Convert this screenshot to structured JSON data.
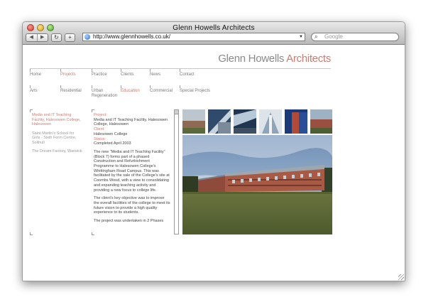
{
  "window": {
    "title": "Glenn Howells Architects"
  },
  "browser": {
    "back_icon": "back-arrow-icon",
    "forward_icon": "forward-arrow-icon",
    "reload_label": "↻",
    "add_label": "+",
    "url": "http://www.glennhowells.co.uk/",
    "search_placeholder": "Google"
  },
  "brand": {
    "name_primary": "Glenn Howells",
    "name_accent": "Architects",
    "accent_color": "#c87d73"
  },
  "nav_main": [
    {
      "label": "Home",
      "active": false
    },
    {
      "label": "Projects",
      "active": true
    },
    {
      "label": "Practice",
      "active": false
    },
    {
      "label": "Clients",
      "active": false
    },
    {
      "label": "News",
      "active": false
    },
    {
      "label": "Contact",
      "active": false
    }
  ],
  "nav_sub": [
    {
      "label": "Arts",
      "active": false
    },
    {
      "label": "Residential",
      "active": false
    },
    {
      "label": "Urban Regeneration",
      "active": false
    },
    {
      "label": "Education",
      "active": true
    },
    {
      "label": "Commercial",
      "active": false
    },
    {
      "label": "Special Projects",
      "active": false
    }
  ],
  "project_list": [
    {
      "label": "Media and IT Teaching Facility, Halesowen College, Halesowen",
      "active": true
    },
    {
      "label": "Saint Martin's School for Girls - Sixth Form Centre, Solihull",
      "active": false
    },
    {
      "label": "The Dream Factory, Warwick",
      "active": false
    }
  ],
  "detail": {
    "project_label": "Project:",
    "project_value": "Media and IT Teaching Facility, Halesowen College, Halesowen",
    "client_label": "Client:",
    "client_value": "Halesowen College",
    "status_label": "Status:",
    "status_value": "Completed April 2003",
    "paragraphs": [
      "The new \"Media and IT Teaching Facility\" (Block 7) forms part of a phased Construction and Refurbishment Programme to Halesowen College's Whittingham Road Campus. This was facilitated by the sale of the College's site at Coombs Wood, with a view to consolidating and expanding teaching activity and providing a new focus to college life.",
      "The client's key objective was to improve the overall facilities of the college to meet its future vision to provide a high quality experience to its students.",
      "The project was undertaken in 2 Phases"
    ]
  },
  "gallery": {
    "thumb_count_shown": 6
  }
}
